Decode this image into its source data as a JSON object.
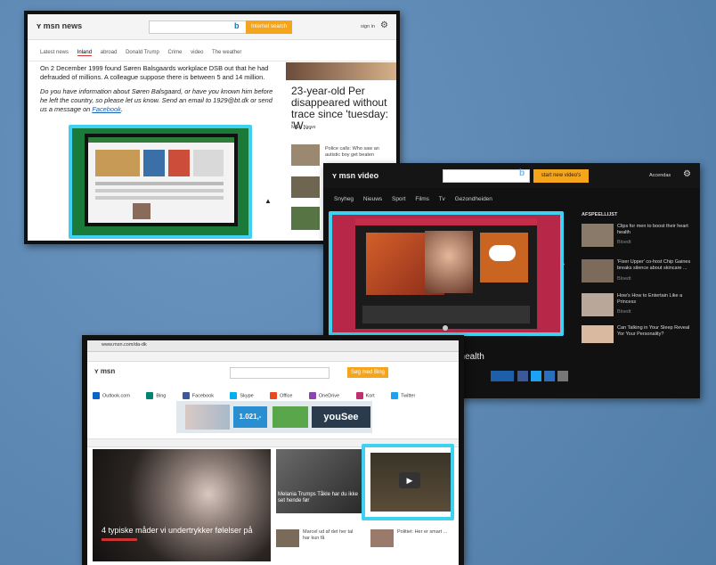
{
  "news": {
    "logo": "msn news",
    "search_button": "Internet search",
    "signin": "sign in",
    "tabs": [
      "Latest news",
      "Inland",
      "abroad",
      "Donald Trump",
      "Crime",
      "video",
      "The weather"
    ],
    "para1": "On 2 December 1999 found Søren Balsgaards workplace DSB out that he had defrauded of millions. A colleague suppose there is between 5 and 14 million.",
    "para2": "Do you have information about Søren Balsgaard, or have you known him before he left the country, so please let us know. Send an email to 1929@bt.dk or send us a message on ",
    "para2_link": "Facebook",
    "side_headline": "23-year-old Per disappeared without trace since 'tuesday: 'W...",
    "side_source": "MSN News",
    "side_small": "Police calls: Who saw an autistic boy get beaten"
  },
  "video": {
    "logo": "msn video",
    "search_button": "start new video's",
    "account": "Accendas",
    "nav": [
      "Snyheg",
      "Nieuws",
      "Sport",
      "Films",
      "Tv",
      "Gezondheiden"
    ],
    "side_title": "AFSPEELLIJST",
    "items": [
      {
        "title": "Clips for men to boost their heart health",
        "meta": "Bloedt"
      },
      {
        "title": "'Fixer Upper' co-host Chip Gaines breaks silence about skincare ...",
        "meta": "Bloedt"
      },
      {
        "title": "How's How to Entertain Like a Princess",
        "meta": "Bloedt"
      },
      {
        "title": "Can Talking in Your Sleep Reveal Yor Your Personality?",
        "meta": ""
      }
    ],
    "caption": "t health"
  },
  "dk": {
    "url": "www.msn.com/da-dk",
    "logo": "msn",
    "search_button": "Søg med Bing",
    "apps": [
      "Outlook.com",
      "Bing",
      "Facebook",
      "Skype",
      "Office",
      "OneDrive",
      "Kort",
      "Twitter"
    ],
    "ad_price": "1.021,-",
    "ad_brand": "youSee",
    "main_caption": "4 typiske måder vi undertrykker følelser på",
    "mid_caption": "Melania Trumps Tåkle har du ikke set hende før",
    "bottom_item1": "Marcel ud af det her tal har kun få",
    "bottom_item2": "Politiet: Her er smart ..."
  }
}
